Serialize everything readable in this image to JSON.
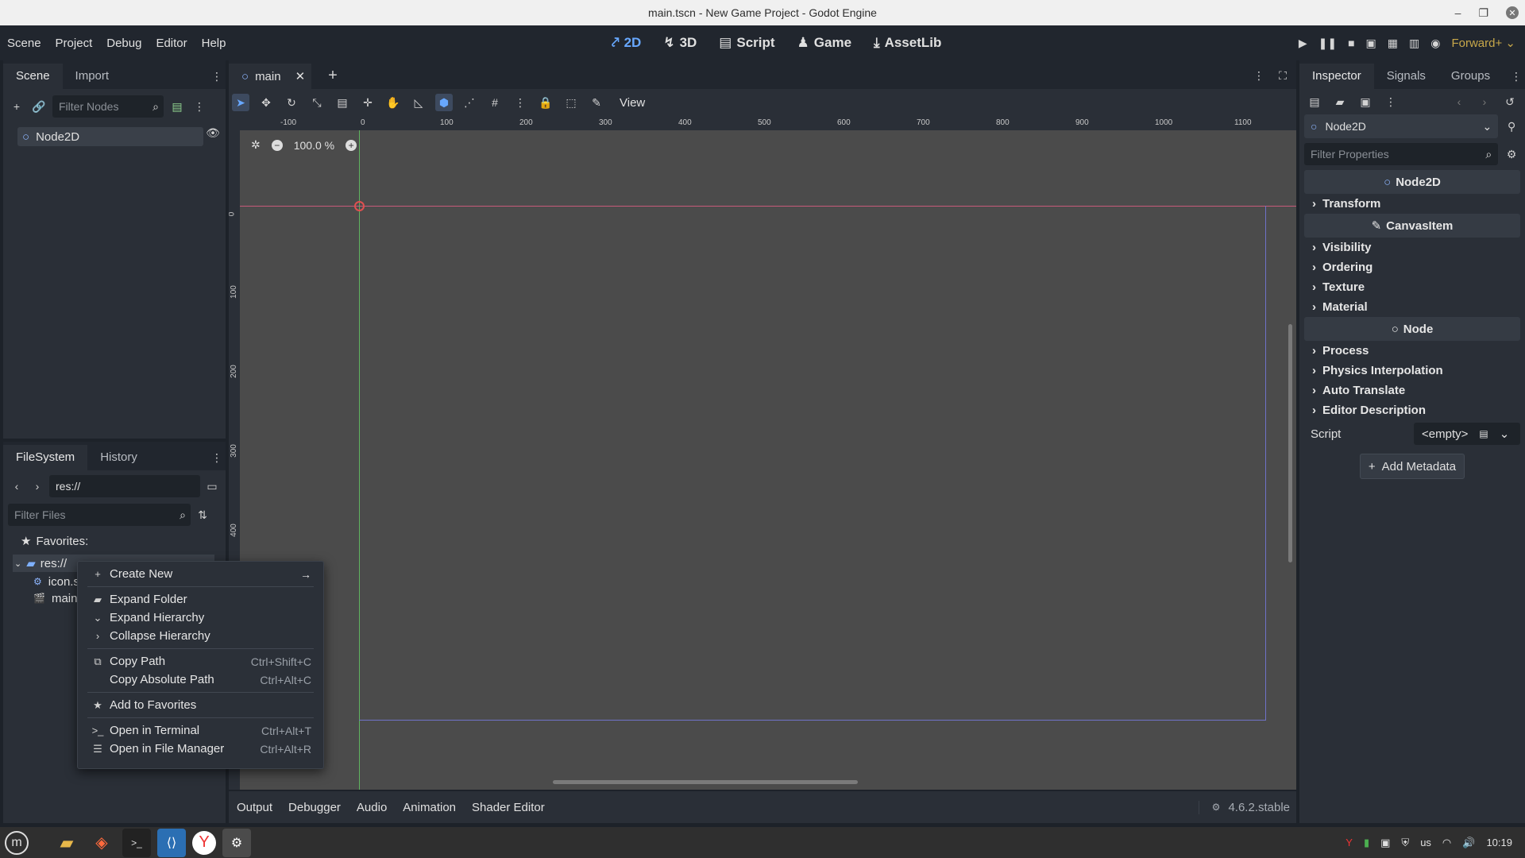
{
  "window": {
    "title": "main.tscn - New Game Project - Godot Engine"
  },
  "menubar": {
    "items": [
      "Scene",
      "Project",
      "Debug",
      "Editor",
      "Help"
    ]
  },
  "main_screens": {
    "two_d": "2D",
    "three_d": "3D",
    "script": "Script",
    "game": "Game",
    "assetlib": "AssetLib"
  },
  "renderer": "Forward+",
  "scene_dock": {
    "tabs": [
      "Scene",
      "Import"
    ],
    "filter_placeholder": "Filter Nodes",
    "root_node": "Node2D"
  },
  "editor_tabs": {
    "scene_tab": "main"
  },
  "toolbar": {
    "view_label": "View"
  },
  "viewport": {
    "zoom": "100.0 %",
    "ruler_h": [
      "-100",
      "0",
      "100",
      "200",
      "300",
      "400",
      "500",
      "600",
      "700",
      "800",
      "900",
      "1000",
      "1100"
    ],
    "ruler_v": [
      "0",
      "100",
      "200",
      "300",
      "400"
    ]
  },
  "filesystem": {
    "tabs": [
      "FileSystem",
      "History"
    ],
    "path": "res://",
    "filter_placeholder": "Filter Files",
    "favorites": "Favorites:",
    "root": "res://",
    "files": [
      "icon.s",
      "main."
    ]
  },
  "context_menu": {
    "items": [
      {
        "label": "Create New",
        "icon": "plus-icon",
        "shortcut": "",
        "submenu": true
      },
      {
        "label": "Expand Folder",
        "icon": "folder-icon",
        "shortcut": ""
      },
      {
        "label": "Expand Hierarchy",
        "icon": "chevron-down-icon",
        "shortcut": ""
      },
      {
        "label": "Collapse Hierarchy",
        "icon": "chevron-right-icon",
        "shortcut": ""
      },
      {
        "label": "Copy Path",
        "icon": "copy-icon",
        "shortcut": "Ctrl+Shift+C"
      },
      {
        "label": "Copy Absolute Path",
        "icon": "",
        "shortcut": "Ctrl+Alt+C"
      },
      {
        "label": "Add to Favorites",
        "icon": "star-icon",
        "shortcut": ""
      },
      {
        "label": "Open in Terminal",
        "icon": "terminal-icon",
        "shortcut": "Ctrl+Alt+T"
      },
      {
        "label": "Open in File Manager",
        "icon": "file-manager-icon",
        "shortcut": "Ctrl+Alt+R"
      }
    ]
  },
  "bottom_panel": {
    "tabs": [
      "Output",
      "Debugger",
      "Audio",
      "Animation",
      "Shader Editor"
    ],
    "version": "4.6.2.stable"
  },
  "inspector": {
    "tabs": [
      "Inspector",
      "Signals",
      "Groups"
    ],
    "node_selector": "Node2D",
    "filter_placeholder": "Filter Properties",
    "sections": {
      "node2d": "Node2D",
      "transform": "Transform",
      "canvasitem": "CanvasItem",
      "visibility": "Visibility",
      "ordering": "Ordering",
      "texture": "Texture",
      "material": "Material",
      "node": "Node",
      "process": "Process",
      "physics_interpolation": "Physics Interpolation",
      "auto_translate": "Auto Translate",
      "editor_description": "Editor Description"
    },
    "script_label": "Script",
    "script_value": "<empty>",
    "add_metadata": "Add Metadata"
  },
  "taskbar": {
    "keyboard_layout": "us",
    "clock": "10:19"
  },
  "colors": {
    "accent": "#68a8ff",
    "viewport_bg": "#4b4b4b",
    "panel_bg": "#2a2f37"
  }
}
